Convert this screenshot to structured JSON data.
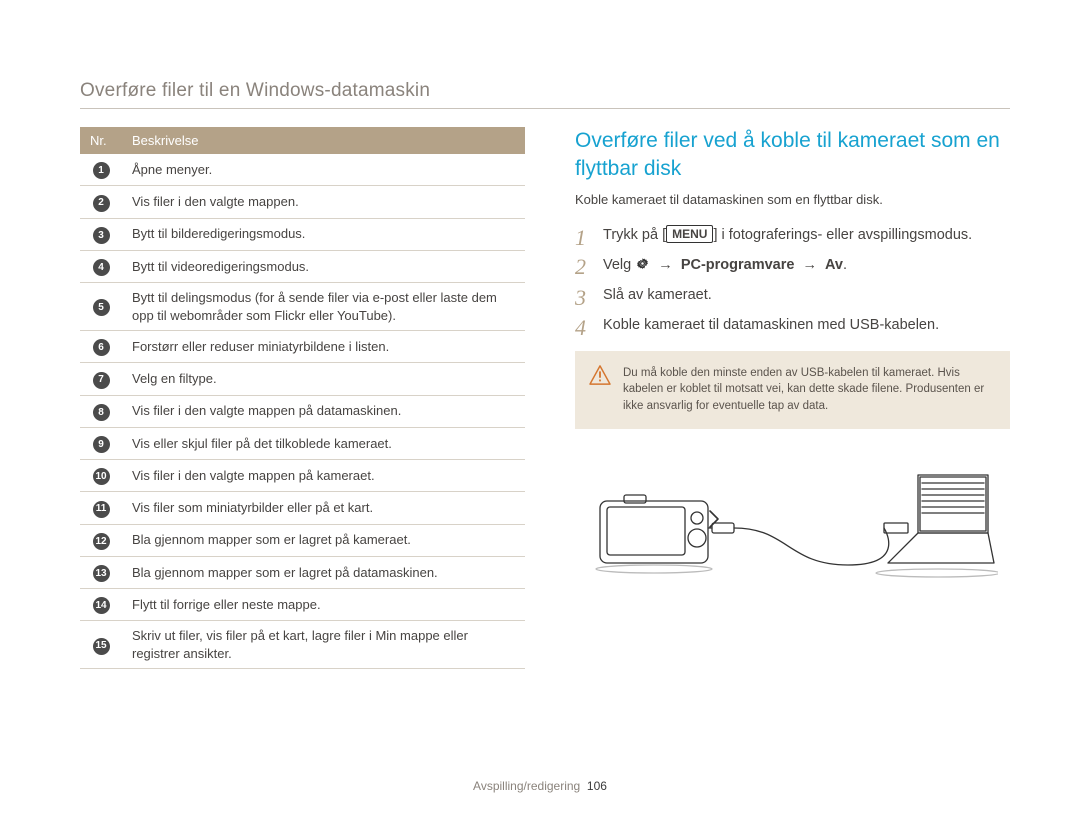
{
  "header": {
    "title": "Overføre filer til en Windows-datamaskin"
  },
  "table": {
    "head": {
      "col1": "Nr.",
      "col2": "Beskrivelse"
    },
    "rows": [
      {
        "n": "1",
        "desc": "Åpne menyer."
      },
      {
        "n": "2",
        "desc": "Vis filer i den valgte mappen."
      },
      {
        "n": "3",
        "desc": "Bytt til bilderedigeringsmodus."
      },
      {
        "n": "4",
        "desc": "Bytt til videoredigeringsmodus."
      },
      {
        "n": "5",
        "desc": "Bytt til delingsmodus (for å sende filer via e-post eller laste dem opp til webområder som Flickr eller YouTube)."
      },
      {
        "n": "6",
        "desc": "Forstørr eller reduser miniatyrbildene i listen."
      },
      {
        "n": "7",
        "desc": "Velg en filtype."
      },
      {
        "n": "8",
        "desc": "Vis filer i den valgte mappen på datamaskinen."
      },
      {
        "n": "9",
        "desc": "Vis eller skjul filer på det tilkoblede kameraet."
      },
      {
        "n": "10",
        "desc": "Vis filer i den valgte mappen på kameraet."
      },
      {
        "n": "11",
        "desc": "Vis filer som miniatyrbilder eller på et kart."
      },
      {
        "n": "12",
        "desc": "Bla gjennom mapper som er lagret på kameraet."
      },
      {
        "n": "13",
        "desc": "Bla gjennom mapper som er lagret på datamaskinen."
      },
      {
        "n": "14",
        "desc": "Flytt til forrige eller neste mappe."
      },
      {
        "n": "15",
        "desc": "Skriv ut filer, vis filer på et kart, lagre filer i Min mappe eller registrer ansikter."
      }
    ]
  },
  "section": {
    "title": "Overføre filer ved å koble til kameraet som en flyttbar disk",
    "intro": "Koble kameraet til datamaskinen som en flyttbar disk.",
    "steps": {
      "s1_pre": "Trykk på [",
      "s1_btn": "MENU",
      "s1_post": "] i fotograferings- eller avspillingsmodus.",
      "s2_pre": "Velg ",
      "s2_path_a": "PC-programvare",
      "s2_path_b": "Av",
      "s2_arrow": "→",
      "s3": "Slå av kameraet.",
      "s4": "Koble kameraet til datamaskinen med USB-kabelen."
    },
    "note": "Du må koble den minste enden av USB-kabelen til kameraet. Hvis kabelen er koblet til motsatt vei, kan dette skade filene. Produsenten er ikke ansvarlig for eventuelle tap av data."
  },
  "footer": {
    "section": "Avspilling/redigering",
    "page": "106"
  }
}
